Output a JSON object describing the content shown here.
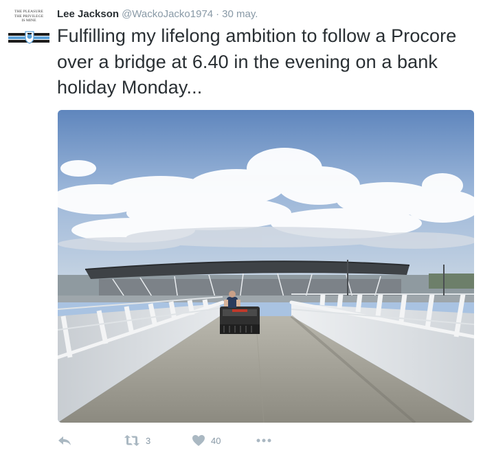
{
  "avatar": {
    "lines": [
      "THE PLEASURE",
      "THE PRIVILEGE",
      "IS MINE"
    ]
  },
  "tweet": {
    "name": "Lee Jackson",
    "handle": "@WackoJacko1974",
    "separator": "·",
    "time": "30 may.",
    "text": "Fulfilling my lifelong ambition to follow a Procore over a bridge at 6.40 in the evening on a bank holiday Monday...",
    "media_description_icon": "photo"
  },
  "actions": {
    "reply_icon": "reply-icon",
    "retweet_icon": "retweet-icon",
    "retweet_count": "3",
    "like_icon": "heart-icon",
    "like_count": "40",
    "more_icon": "more-icon"
  },
  "colors": {
    "name": "#292f33",
    "muted": "#8899a6",
    "text": "#292f33"
  }
}
